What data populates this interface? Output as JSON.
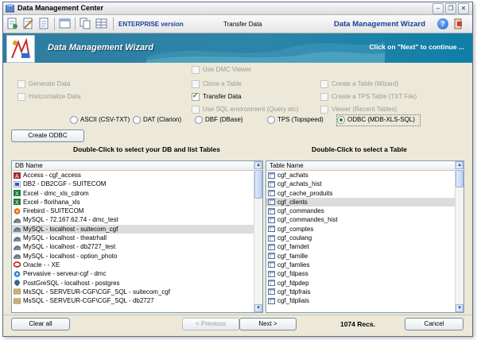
{
  "window": {
    "title": "Data Management Center"
  },
  "toolbar": {
    "edition": "ENTERPRISE version",
    "mode": "Transfer Data",
    "wizard_title": "Data Management Wizard",
    "help_glyph": "?"
  },
  "banner": {
    "title": "Data Management Wizard",
    "hint": "Click on \"Next\" to continue ..."
  },
  "options": {
    "generate_data": "Generate Data",
    "horizontalize_data": "Horizontalize Data",
    "use_dmc_viewer": "Use DMC Viewer",
    "clone_table": "Clone a Table",
    "transfer_data": "Transfer Data",
    "use_sql_env": "Use SQL environment (Query etc)",
    "create_table_wizard": "Create a Table (Wizard)",
    "create_tps_table": "Create a TPS Table (TXT File)",
    "viewer_recent": "Viewer (Recent Tables)"
  },
  "formats": [
    "ASCII (CSV-TXT)",
    "DAT (Clarion)",
    "DBF (DBase)",
    "TPS (Topspeed)",
    "ODBC (MDB-XLS-SQL)"
  ],
  "selected_format": "ODBC (MDB-XLS-SQL)",
  "create_odbc_label": "Create ODBC",
  "left_panel": {
    "heading": "Double-Click to select your DB and list Tables",
    "column": "DB Name",
    "items": [
      "Access - cgf_access",
      "DB2 - DB2CGF - SUITECOM",
      "Excel - dmc_xls_cdrom",
      "Excel - florihana_xls",
      "Firebird - SUITECOM",
      "MySQL - 72.167.62.74 - dmc_test",
      "MySQL - localhost - suitecom_cgf",
      "MySQL - localhost - theatrhall",
      "MySQL - localhost - db2727_test",
      "MySQL - localhost - option_photo",
      "Oracle -  - XE",
      "Pervasive - serveur-cgf - dmc",
      "PostGreSQL - localhost - postgres",
      "MsSQL - SERVEUR-CGF\\CGF_SQL - suitecom_cgf",
      "MsSQL - SERVEUR-CGF\\CGF_SQL - db2727"
    ],
    "selected": "MySQL - localhost - suitecom_cgf"
  },
  "right_panel": {
    "heading": "Double-Click to select a Table",
    "column": "Table Name",
    "items": [
      "cgf_achats",
      "cgf_achats_hist",
      "cgf_cache_produits",
      "cgf_clients",
      "cgf_commandes",
      "cgf_commandes_hist",
      "cgf_comptes",
      "cgf_coulang",
      "cgf_famdet",
      "cgf_famille",
      "cgf_famlies",
      "cgf_fdpass",
      "cgf_fdpdep",
      "cgf_fdpfrais",
      "cgf_fdpliais"
    ],
    "selected": "cgf_clients"
  },
  "buttons": {
    "clear_all": "Clear all",
    "previous": "< Previous",
    "next": "Next >",
    "cancel": "Cancel"
  },
  "records": "1074 Recs.",
  "icons": {
    "access": "access-icon",
    "db2": "db2-icon",
    "excel": "excel-icon",
    "firebird": "firebird-icon",
    "mysql": "mysql-icon",
    "oracle": "oracle-icon",
    "pervasive": "pervasive-icon",
    "postgres": "postgres-icon",
    "mssql": "mssql-icon",
    "table": "table-icon"
  }
}
